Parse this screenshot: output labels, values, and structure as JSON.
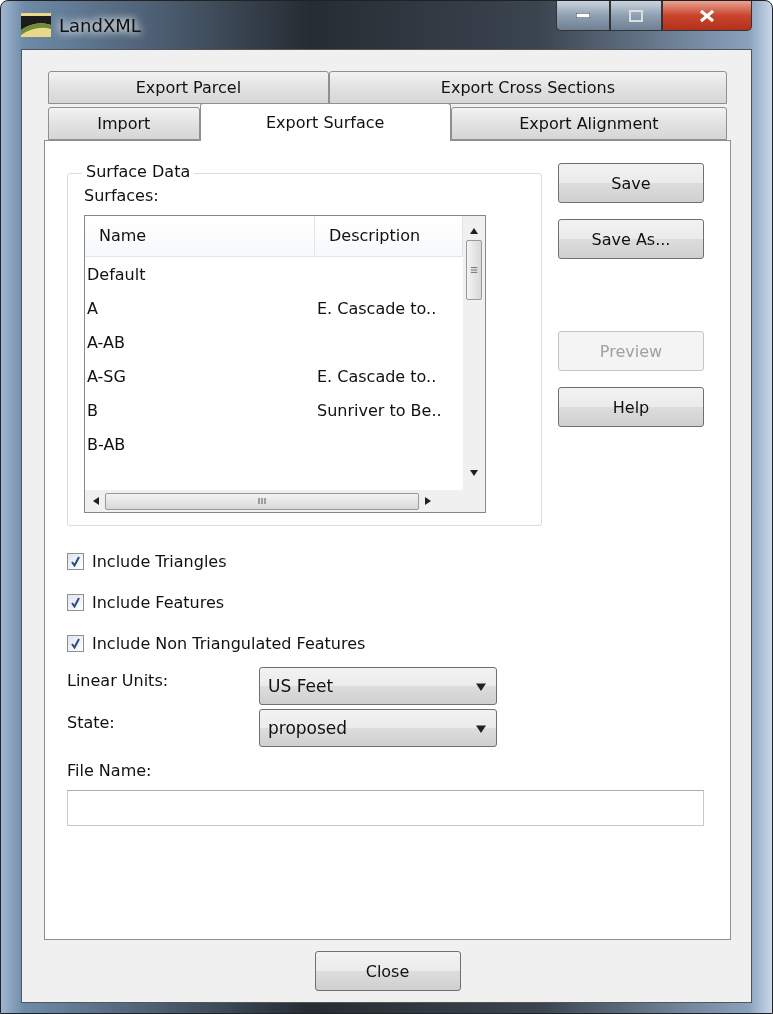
{
  "window": {
    "title": "LandXML"
  },
  "tab_rows": [
    [
      {
        "label": "Export Parcel",
        "selected": false
      },
      {
        "label": "Export Cross Sections",
        "selected": false
      }
    ],
    [
      {
        "label": "Import",
        "selected": false
      },
      {
        "label": "Export Surface",
        "selected": true
      },
      {
        "label": "Export Alignment",
        "selected": false
      }
    ]
  ],
  "surface_data": {
    "title": "Surface Data",
    "list_label": "Surfaces:",
    "columns": [
      "Name",
      "Description"
    ],
    "rows": [
      {
        "name": "Default"
      },
      {
        "name": "A",
        "description": "E. Cascade to.."
      },
      {
        "name": "A-AB"
      },
      {
        "name": "A-SG",
        "description": "E. Cascade to.."
      },
      {
        "name": "B",
        "description": "Sunriver to Be.."
      },
      {
        "name": "B-AB"
      }
    ]
  },
  "side_buttons": [
    {
      "label": "Save",
      "disabled": false
    },
    {
      "label": "Save As...",
      "disabled": false
    },
    {
      "label": "Preview",
      "disabled": true
    },
    {
      "label": "Help",
      "disabled": false
    }
  ],
  "options": [
    {
      "label": "Include Triangles",
      "checked": true
    },
    {
      "label": "Include Features",
      "checked": true
    },
    {
      "label": "Include Non Triangulated Features",
      "checked": true
    }
  ],
  "dropdowns": [
    {
      "label": "Linear Units:",
      "value": "US Feet"
    },
    {
      "label": "State:",
      "value": "proposed"
    }
  ],
  "file_name": {
    "label": "File Name:"
  },
  "footer_buttons": [
    "Close"
  ]
}
